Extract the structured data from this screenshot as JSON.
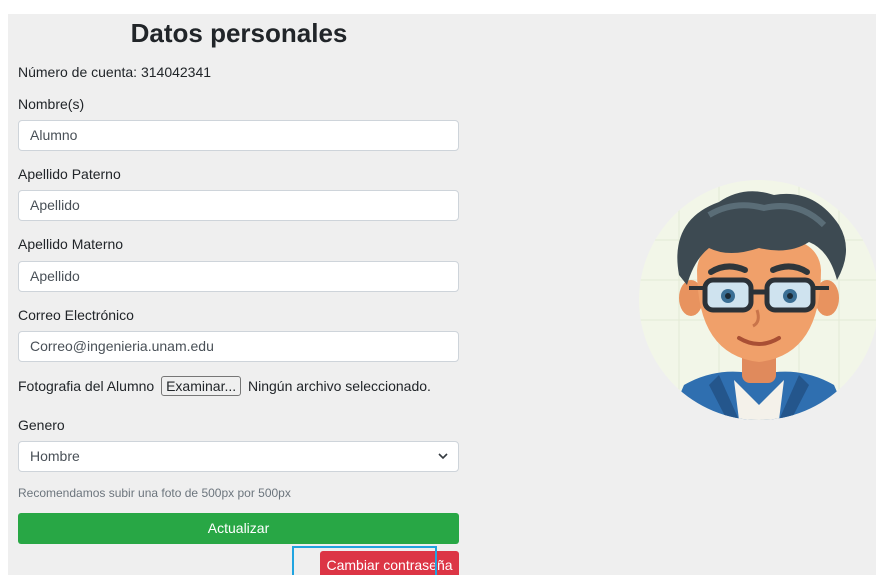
{
  "form": {
    "title": "Datos personales",
    "account_label": "Número de cuenta: 314042341",
    "nombre_label": "Nombre(s)",
    "nombre_value": "Alumno",
    "ap_paterno_label": "Apellido Paterno",
    "ap_paterno_value": "Apellido",
    "ap_materno_label": "Apellido Materno",
    "ap_materno_value": "Apellido",
    "email_label": "Correo Electrónico",
    "email_value": "Correo@ingenieria.unam.edu",
    "photo_label": "Fotografia del Alumno",
    "browse_label": "Examinar...",
    "no_file_label": "Ningún archivo seleccionado.",
    "genero_label": "Genero",
    "genero_selected": "Hombre",
    "hint": "Recomendamos subir una foto de 500px por 500px",
    "update_button": "Actualizar",
    "password_button": "Cambiar contraseña"
  },
  "icons": {
    "select_arrow": "chevron-down-icon",
    "avatar": "student-avatar"
  },
  "colors": {
    "panel_bg": "#efefef",
    "update_button": "#28a745",
    "password_button": "#dc3545",
    "focus_outline": "#20a4e0"
  }
}
